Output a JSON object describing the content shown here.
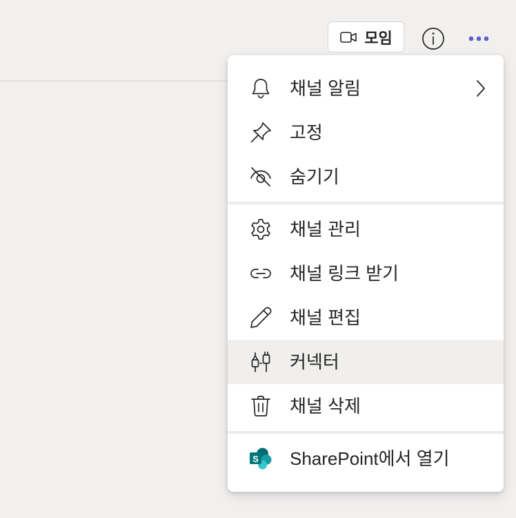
{
  "header": {
    "meet_button": {
      "label": "모임",
      "icon": "video-camera-icon"
    },
    "info_button": {
      "icon": "info-icon"
    },
    "more_button": {
      "icon": "more-horizontal-icon",
      "accent_color": "#5b5fc7"
    }
  },
  "menu": {
    "items": [
      {
        "label": "채널 알림",
        "icon": "bell-icon",
        "has_submenu": true
      },
      {
        "label": "고정",
        "icon": "pin-icon"
      },
      {
        "label": "숨기기",
        "icon": "eye-off-icon"
      },
      {
        "label": "채널 관리",
        "icon": "gear-icon"
      },
      {
        "label": "채널 링크 받기",
        "icon": "link-icon"
      },
      {
        "label": "채널 편집",
        "icon": "pencil-icon"
      },
      {
        "label": "커넥터",
        "icon": "connector-plug-icon",
        "hovered": true
      },
      {
        "label": "채널 삭제",
        "icon": "trash-icon"
      },
      {
        "label": "SharePoint에서 열기",
        "icon": "sharepoint-icon"
      }
    ]
  },
  "colors": {
    "background": "#f1f0ef",
    "menu_background": "#ffffff",
    "hover_background": "#f0efee",
    "text": "#242424",
    "accent": "#5b5fc7",
    "sharepoint_dark": "#036c70",
    "sharepoint_mid": "#1a9ba1",
    "sharepoint_light": "#37c6d0"
  }
}
